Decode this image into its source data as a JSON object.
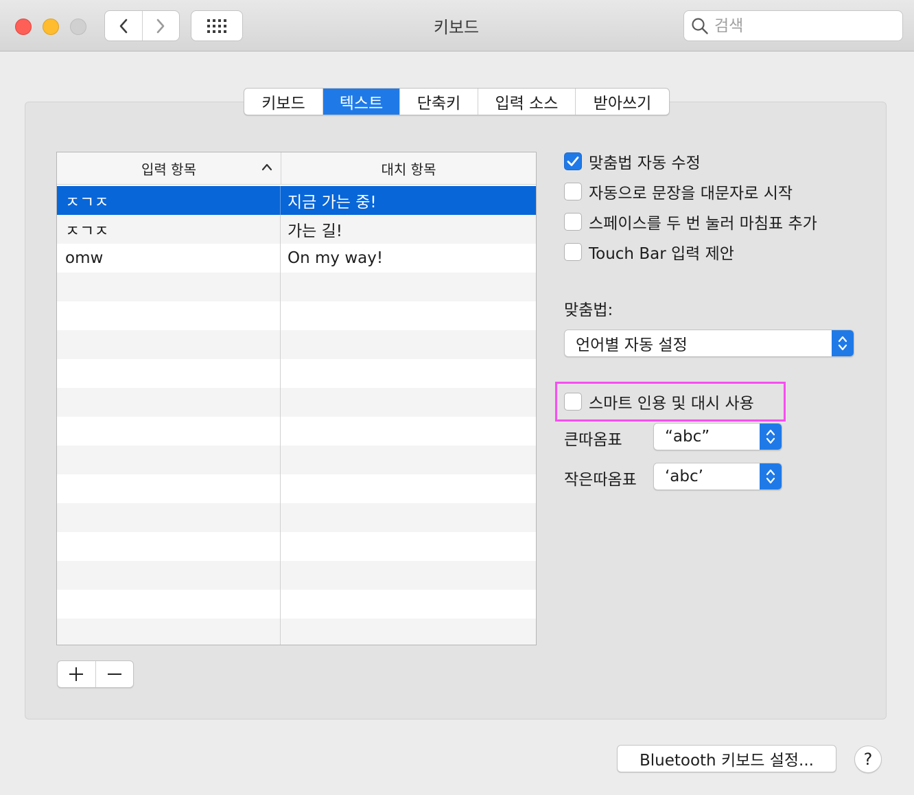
{
  "window": {
    "title": "키보드",
    "search_placeholder": "검색"
  },
  "tabs": [
    {
      "label": "키보드",
      "active": false
    },
    {
      "label": "텍스트",
      "active": true
    },
    {
      "label": "단축키",
      "active": false
    },
    {
      "label": "입력 소스",
      "active": false
    },
    {
      "label": "받아쓰기",
      "active": false
    }
  ],
  "table": {
    "columns": [
      "입력 항목",
      "대치 항목"
    ],
    "rows": [
      {
        "replace": "ㅈㄱㅈ",
        "with": "지금 가는 중!",
        "selected": true
      },
      {
        "replace": "ㅈㄱㅈ",
        "with": "가는 길!",
        "selected": false
      },
      {
        "replace": "omw",
        "with": "On my way!",
        "selected": false
      }
    ],
    "add_label": "+",
    "remove_label": "−"
  },
  "options": {
    "autocorrect": {
      "label": "맞춤법 자동 수정",
      "checked": true
    },
    "autocap": {
      "label": "자동으로 문장을 대문자로 시작",
      "checked": false
    },
    "doublespace": {
      "label": "스페이스를 두 번 눌러 마침표 추가",
      "checked": false
    },
    "touchbar": {
      "label": "Touch Bar 입력 제안",
      "checked": false
    }
  },
  "spelling": {
    "label": "맞춤법:",
    "value": "언어별 자동 설정"
  },
  "smart_quotes": {
    "label": "스마트 인용 및 대시 사용",
    "checked": false,
    "double_label": "큰따옴표",
    "double_value": "“abc”",
    "single_label": "작은따옴표",
    "single_value": "‘abc’"
  },
  "footer": {
    "bluetooth_button": "Bluetooth 키보드 설정...",
    "help_label": "?"
  },
  "colors": {
    "accent": "#1f7ae8",
    "selection": "#0866d8",
    "highlight": "#f64ff0"
  }
}
